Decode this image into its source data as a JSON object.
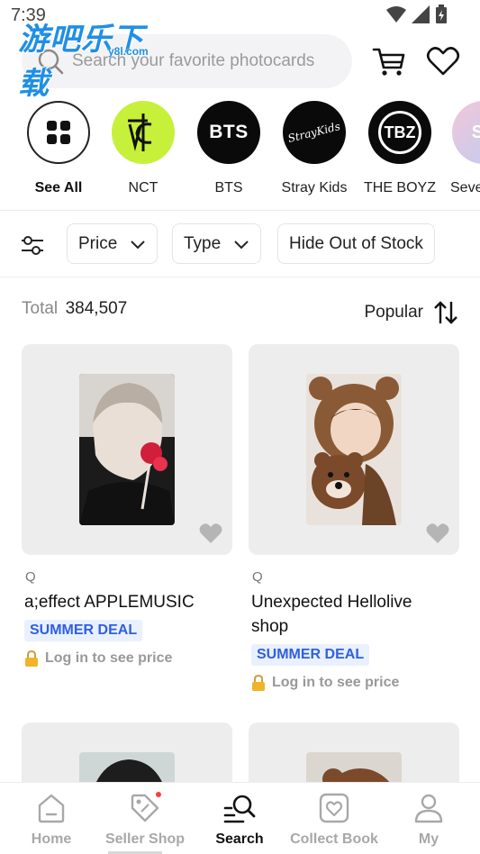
{
  "status": {
    "time": "7:39"
  },
  "watermark": {
    "text": "游吧乐下载",
    "sub": "y8l.com"
  },
  "search": {
    "placeholder": "Search your favorite photocards"
  },
  "artists": [
    {
      "name": "See All"
    },
    {
      "name": "NCT"
    },
    {
      "name": "BTS",
      "logo": "BTS"
    },
    {
      "name": "Stray Kids",
      "logo": "StrayKids"
    },
    {
      "name": "THE BOYZ",
      "logo": "TBZ"
    },
    {
      "name": "Seve",
      "logo": "SV"
    }
  ],
  "filters": {
    "price": "Price",
    "type": "Type",
    "hide": "Hide Out of Stock"
  },
  "results": {
    "total_label": "Total",
    "total_count": "384,507",
    "sort_label": "Popular"
  },
  "products": [
    {
      "brand": "Q",
      "title": "a;effect APPLEMUSIC",
      "badge": "SUMMER DEAL",
      "price_note": "Log in to see price"
    },
    {
      "brand": "Q",
      "title_line1": "Unexpected Hellolive",
      "title_line2": "shop",
      "badge": "SUMMER DEAL",
      "price_note": "Log in to see price"
    }
  ],
  "tabs": [
    {
      "label": "Home",
      "icon": "home-icon"
    },
    {
      "label": "Seller Shop",
      "icon": "tag-icon"
    },
    {
      "label": "Search",
      "icon": "search-list-icon"
    },
    {
      "label": "Collect Book",
      "icon": "collect-book-icon"
    },
    {
      "label": "My",
      "icon": "user-icon"
    }
  ],
  "colors": {
    "accent_badge_bg": "#e9f0ff",
    "accent_badge_text": "#2f5fe0",
    "nct_green": "#c6f03a",
    "notification_dot": "#ff3b3b"
  }
}
